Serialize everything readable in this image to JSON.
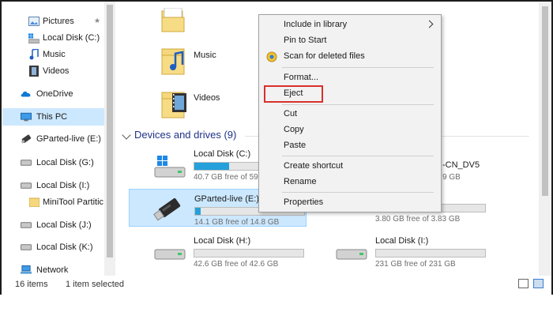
{
  "sidebar": {
    "items": [
      {
        "label": "Pictures",
        "icon": "pictures-icon",
        "pinned": true
      },
      {
        "label": "Local Disk (C:)",
        "icon": "local-disk-icon"
      },
      {
        "label": "Music",
        "icon": "music-icon"
      },
      {
        "label": "Videos",
        "icon": "videos-icon"
      },
      {
        "label": "OneDrive",
        "icon": "onedrive-icon"
      },
      {
        "label": "This PC",
        "icon": "this-pc-icon",
        "selected": true
      },
      {
        "label": "GParted-live (E:)",
        "icon": "usb-drive-icon"
      },
      {
        "label": "Local Disk (G:)",
        "icon": "drive-icon"
      },
      {
        "label": "Local Disk (I:)",
        "icon": "drive-icon"
      },
      {
        "label": "MiniTool Partitic",
        "icon": "folder-icon"
      },
      {
        "label": "Local Disk (J:)",
        "icon": "drive-icon"
      },
      {
        "label": "Local Disk (K:)",
        "icon": "drive-icon"
      },
      {
        "label": "Network",
        "icon": "network-icon"
      }
    ]
  },
  "folders": {
    "music": "Music",
    "videos": "Videos"
  },
  "devices": {
    "heading": "Devices and drives (9)",
    "drives": [
      {
        "name": "Local Disk (C:)",
        "free": "40.7 GB free of 59",
        "fill": 0.32,
        "icon": "windows-drive-icon",
        "selected": false
      },
      {
        "name": "GParted-live (E:)",
        "free": "14.1 GB free of 14.8 GB",
        "fill": 0.05,
        "icon": "usb-drive-icon",
        "selected": true
      },
      {
        "name": "Local Disk (H:)",
        "free": "42.6 GB free of 42.6 GB",
        "fill": 0.0,
        "icon": "drive-icon",
        "selected": false
      },
      {
        "name": "Local Disk (I:)",
        "free": "231 GB free of 231 GB",
        "fill": 0.0,
        "icon": "drive-icon",
        "selected": false
      }
    ],
    "partial_right": {
      "name_fragment": "-CN_DV5",
      "free_fragment_1": "9 GB",
      "free_fragment_2": "3.80 GB free of 3.83 GB"
    }
  },
  "context_menu": {
    "items": [
      {
        "label": "Include in library",
        "submenu": true
      },
      {
        "label": "Pin to Start"
      },
      {
        "label": "Scan for deleted files",
        "icon": "scan-icon"
      },
      {
        "label": "Format..."
      },
      {
        "label": "Eject",
        "highlighted": true
      },
      {
        "label": "Cut"
      },
      {
        "label": "Copy"
      },
      {
        "label": "Paste"
      },
      {
        "label": "Create shortcut"
      },
      {
        "label": "Rename"
      },
      {
        "label": "Properties"
      }
    ]
  },
  "status": {
    "item_count": "16 items",
    "selection": "1 item selected"
  },
  "colors": {
    "selection_bg": "#cce8ff",
    "usage_bar": "#26a0da",
    "section_heading": "#1e3287",
    "highlight_box": "#d9302c"
  }
}
